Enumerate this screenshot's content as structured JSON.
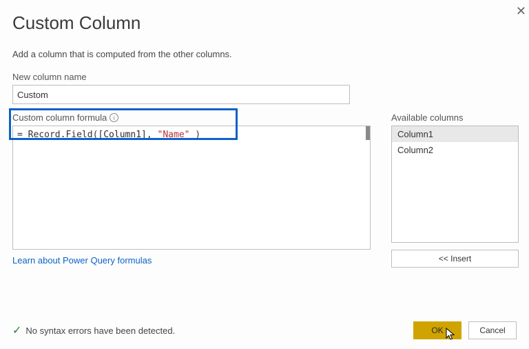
{
  "dialog": {
    "title": "Custom Column",
    "subtitle": "Add a column that is computed from the other columns.",
    "close_glyph": "✕"
  },
  "newColumn": {
    "label": "New column name",
    "value": "Custom"
  },
  "formula": {
    "label": "Custom column formula",
    "prefix": "= ",
    "fn": "Record.Field",
    "open": "(",
    "col": "[Column1]",
    "comma": ", ",
    "str": "\"Name\"",
    "closing": " )"
  },
  "available": {
    "label": "Available columns",
    "items": [
      "Column1",
      "Column2"
    ],
    "selectedIndex": 0,
    "insert_label": "<< Insert"
  },
  "link": {
    "text": "Learn about Power Query formulas"
  },
  "status": {
    "text": "No syntax errors have been detected."
  },
  "buttons": {
    "ok": "OK",
    "cancel": "Cancel"
  }
}
